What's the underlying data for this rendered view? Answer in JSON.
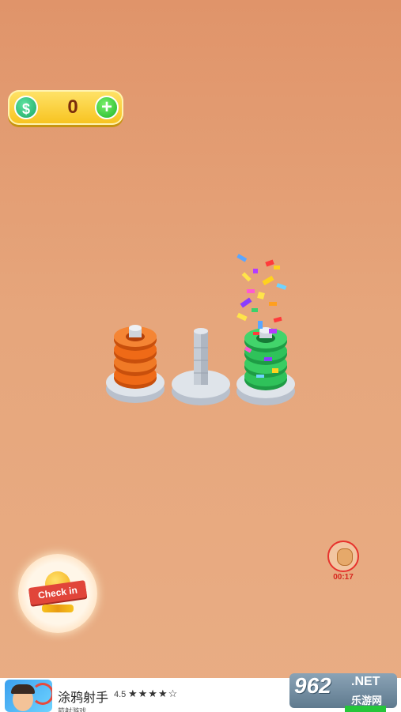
{
  "hud": {
    "coin_symbol": "$",
    "coin_value": "0",
    "add_label": "+"
  },
  "board": {
    "pegs": [
      {
        "rings": 4,
        "ring_color": "#ef6a17"
      },
      {
        "rings": 0,
        "ring_color": ""
      },
      {
        "rings": 4,
        "ring_color": "#2fc25a"
      }
    ],
    "celebration": "confetti"
  },
  "checkin": {
    "label": "Check in"
  },
  "reward_bag": {
    "timer": "00:17"
  },
  "ad": {
    "title": "涂鸦射手",
    "rating": "4.5",
    "stars": "★★★★☆",
    "subtitle": "箭射游戏"
  },
  "watermark": {
    "number": "962",
    "net": ".NET",
    "cn": "乐游网"
  },
  "colors": {
    "accent_yellow": "#f7c21d",
    "coin_green": "#1aa764",
    "timer_red": "#d6281f"
  }
}
